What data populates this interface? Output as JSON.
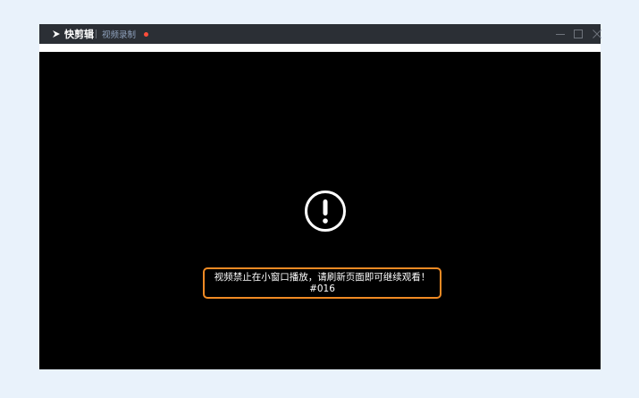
{
  "titlebar": {
    "app_name": "快剪辑",
    "tab_label": "视频录制",
    "recording_indicator_color": "#ff4d3a",
    "icons": [
      "app-logo-icon",
      "minimize-icon",
      "maximize-icon",
      "close-icon"
    ]
  },
  "player": {
    "warning_icon": "exclamation-circle-icon",
    "message": "视频禁止在小窗口播放，请刷新页面即可继续观看！",
    "error_code": "#016",
    "accent_color": "#f08a24"
  }
}
